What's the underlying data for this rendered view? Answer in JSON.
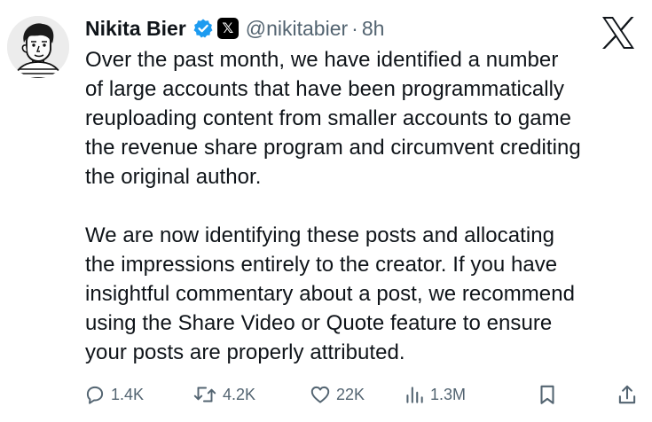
{
  "author": {
    "name": "Nikita Bier",
    "handle": "@nikitabier",
    "separator": "·",
    "time": "8h"
  },
  "badges": {
    "verified_icon": "verified-check-icon",
    "affiliation_icon": "x-affiliate-badge-icon",
    "affiliation_text": "𝕏"
  },
  "brand": {
    "logo_icon": "x-logo-icon",
    "accent": "#1d9bf0",
    "text": "#0f1419",
    "muted": "#536471"
  },
  "tweet": {
    "paragraphs": [
      [
        "Over the past month, we have identified a number",
        "of large accounts that have been programmatically",
        "reuploading content from smaller accounts to game",
        "the revenue share program and circumvent crediting",
        "the original author."
      ],
      [
        "We are now identifying these posts and allocating",
        "the impressions entirely to the creator. If you have",
        "insightful commentary about a post, we recommend",
        "using the Share Video or Quote feature to ensure",
        "your posts are properly attributed."
      ]
    ]
  },
  "actions": {
    "replies": "1.4K",
    "reposts": "4.2K",
    "likes": "22K",
    "views": "1.3M"
  }
}
